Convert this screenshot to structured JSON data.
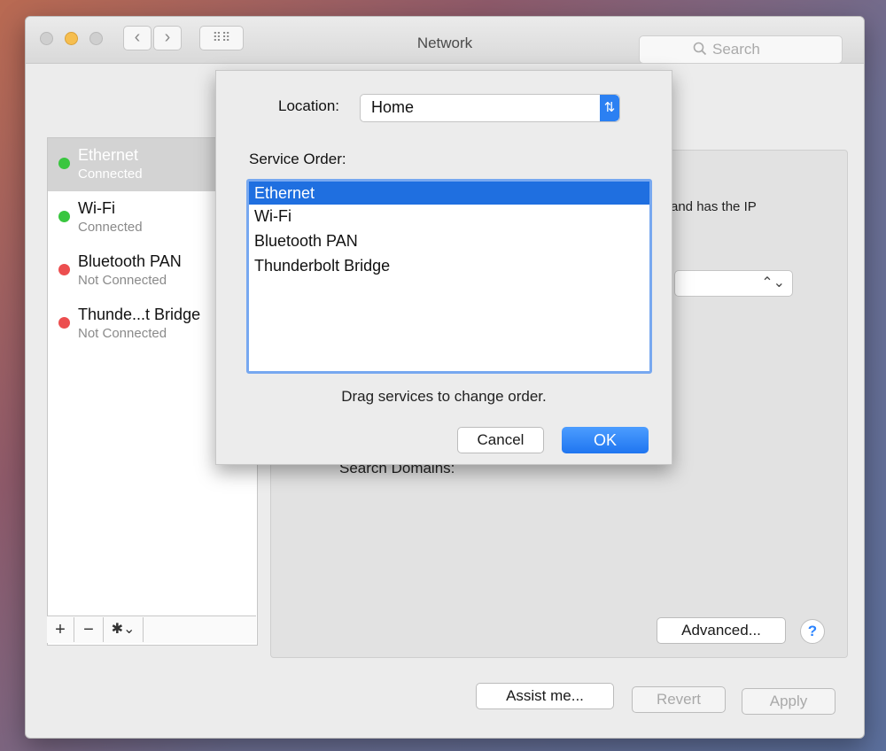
{
  "window": {
    "title": "Network"
  },
  "search": {
    "placeholder": "Search"
  },
  "sidebar": {
    "services": [
      {
        "name": "Ethernet",
        "status": "Connected",
        "status_color": "#39c63f"
      },
      {
        "name": "Wi-Fi",
        "status": "Connected",
        "status_color": "#39c63f"
      },
      {
        "name": "Bluetooth PAN",
        "status": "Not Connected",
        "status_color": "#ec4e4f"
      },
      {
        "name": "Thunde...t Bridge",
        "status": "Not Connected",
        "status_color": "#ec4e4f"
      }
    ],
    "controls": {
      "add": "+",
      "remove": "−",
      "gear": "✱⌄"
    }
  },
  "detail": {
    "ip_note": "and has the IP",
    "search_domains_label": "Search Domains:",
    "advanced_label": "Advanced...",
    "help_label": "?"
  },
  "footer": {
    "assist_label": "Assist me...",
    "revert_label": "Revert",
    "apply_label": "Apply"
  },
  "sheet": {
    "location_label": "Location:",
    "location_value": "Home",
    "service_order_label": "Service Order:",
    "service_order": [
      "Ethernet",
      "Wi-Fi",
      "Bluetooth PAN",
      "Thunderbolt Bridge"
    ],
    "drag_note": "Drag services to change order.",
    "cancel_label": "Cancel",
    "ok_label": "OK"
  },
  "colors": {
    "accent": "#1f6fe0",
    "connected": "#39c63f",
    "disconnected": "#ec4e4f"
  }
}
